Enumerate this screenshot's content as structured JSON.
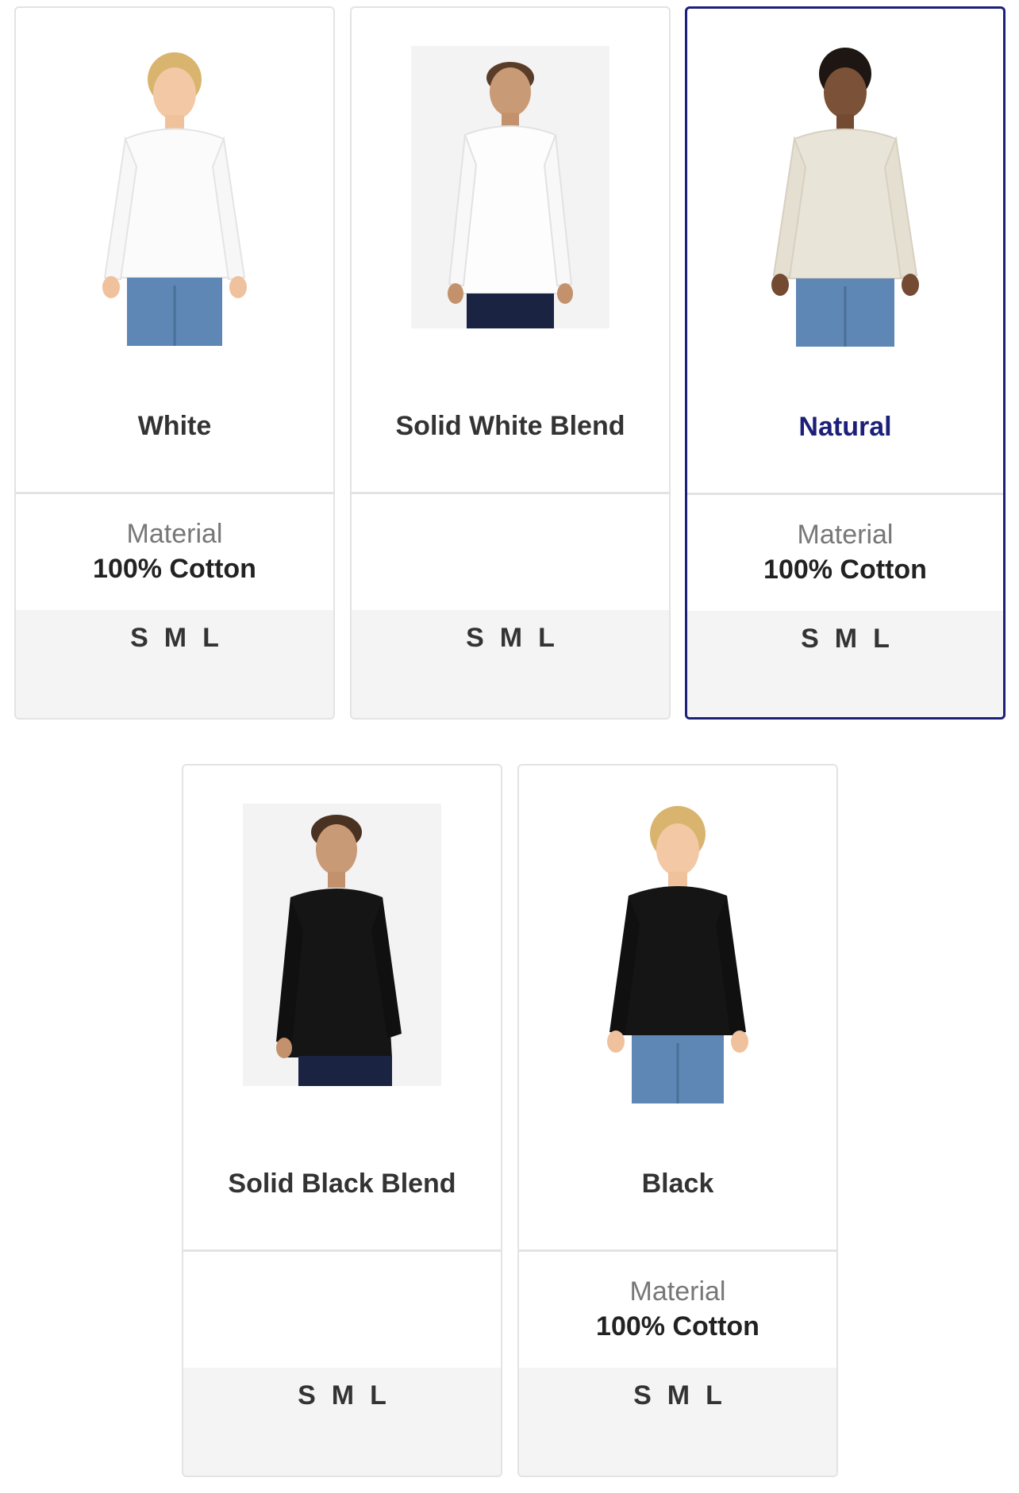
{
  "products": [
    {
      "color": "White",
      "material_label": "Material",
      "material_value": "100% Cotton",
      "sizes": [
        "S",
        "M",
        "L"
      ],
      "selected": false
    },
    {
      "color": "Solid White Blend",
      "material_label": "",
      "material_value": "",
      "sizes": [
        "S",
        "M",
        "L"
      ],
      "selected": false
    },
    {
      "color": "Natural",
      "material_label": "Material",
      "material_value": "100% Cotton",
      "sizes": [
        "S",
        "M",
        "L"
      ],
      "selected": true
    },
    {
      "color": "Solid Black Blend",
      "material_label": "",
      "material_value": "",
      "sizes": [
        "S",
        "M",
        "L"
      ],
      "selected": false
    },
    {
      "color": "Black",
      "material_label": "Material",
      "material_value": "100% Cotton",
      "sizes": [
        "S",
        "M",
        "L"
      ],
      "selected": false
    }
  ],
  "colors": {
    "selected_border": "#1c2078",
    "card_border": "#e3e3e3",
    "sizes_bg": "#f4f4f4",
    "shirt_white": "#fbfbfb",
    "shirt_natural": "#e9e4d8",
    "shirt_black": "#151515",
    "jeans_light": "#5e87b5",
    "jeans_dark": "#1a2442"
  },
  "icons": [
    "model-photo-white",
    "model-photo-solid-white-blend",
    "model-photo-natural",
    "model-photo-solid-black-blend",
    "model-photo-black"
  ]
}
